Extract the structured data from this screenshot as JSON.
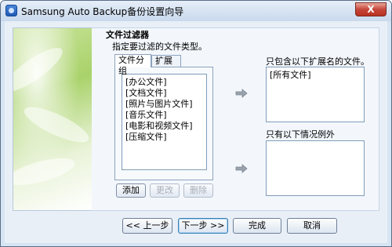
{
  "window": {
    "title": "Samsung Auto Backup备份设置向导",
    "close_glyph": "X"
  },
  "page": {
    "heading": "文件过滤器",
    "subheading": "指定要过滤的文件类型。"
  },
  "tabs": [
    {
      "label": "文件分组",
      "active": true
    },
    {
      "label": "扩展名",
      "active": false
    }
  ],
  "file_groups": [
    "[办公文件]",
    "[文档文件]",
    "[照片与图片文件]",
    "[音乐文件]",
    "[电影和视频文件]",
    "[压缩文件]"
  ],
  "group_buttons": {
    "add": "添加",
    "edit": "更改",
    "delete": "删除"
  },
  "include": {
    "label": "只包含以下扩展名的文件。",
    "items": [
      "[所有文件]"
    ]
  },
  "exclude": {
    "label": "只有以下情况例外"
  },
  "footer": {
    "back": "<< 上一步",
    "next": "下一步 >>",
    "finish": "完成",
    "cancel": "取消"
  },
  "colors": {
    "accent": "#3c7fb1",
    "panel_green": "#a9d26a",
    "close_red": "#c6463a"
  },
  "icons": [
    "app-icon",
    "close-icon",
    "arrow-right-icon"
  ]
}
